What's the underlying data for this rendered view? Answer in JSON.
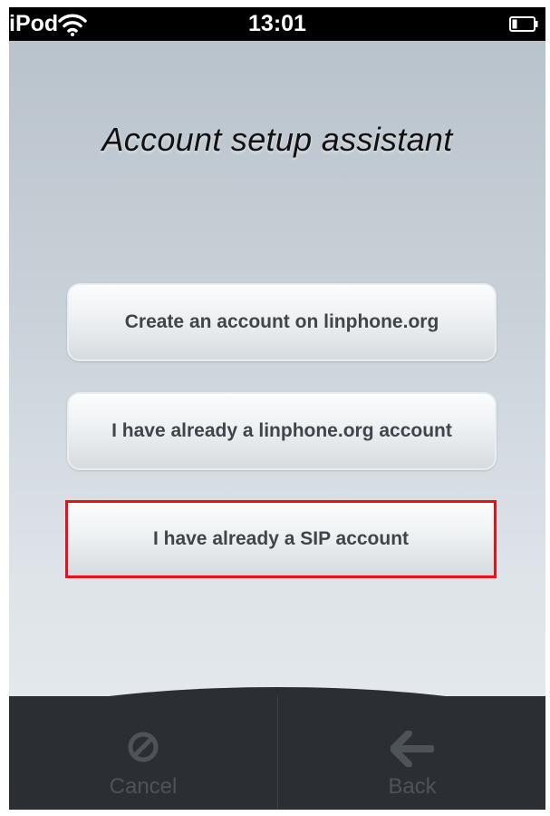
{
  "status_bar": {
    "carrier": "iPod",
    "time": "13:01",
    "icons": {
      "wifi": "wifi-icon",
      "battery": "battery-icon"
    }
  },
  "screen": {
    "title": "Account setup assistant"
  },
  "buttons": {
    "create_account": "Create an account on linphone.org",
    "linphone_account": "I have already a linphone.org account",
    "sip_account": "I have already a SIP account"
  },
  "tab_bar": {
    "cancel_label": "Cancel",
    "back_label": "Back",
    "icons": {
      "cancel": "cancel-icon",
      "back": "back-arrow-icon"
    }
  },
  "colors": {
    "highlight_border": "#e9101a",
    "tab_bar_bg": "#2b2f33",
    "button_text": "#3f454b"
  }
}
